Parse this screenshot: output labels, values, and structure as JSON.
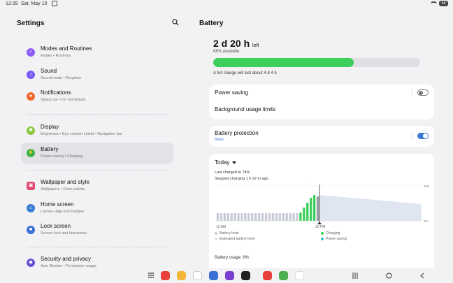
{
  "status": {
    "time": "12:39",
    "date": "Sat, May 10",
    "battery": "68"
  },
  "left": {
    "title": "Settings",
    "groups": [
      {
        "items": [
          {
            "label": "Modes and Routines",
            "sub": "Modes • Routines",
            "icon": "modes-icon",
            "color": "#8b5cf6"
          },
          {
            "label": "Sound",
            "sub": "Sound mode • Ringtone",
            "icon": "sound-icon",
            "color": "#7c5cf6"
          },
          {
            "label": "Notifications",
            "sub": "Status bar • Do not disturb",
            "icon": "bell-icon",
            "color": "#f06a2e"
          }
        ]
      },
      {
        "items": [
          {
            "label": "Display",
            "sub": "Brightness • Eye comfort shield • Navigation bar",
            "icon": "sun-icon",
            "color": "#8cc63f"
          },
          {
            "label": "Battery",
            "sub": "Power saving • Charging",
            "icon": "battery-icon",
            "color": "#3bb34a"
          }
        ]
      },
      {
        "items": [
          {
            "label": "Wallpaper and style",
            "sub": "Wallpapers • Color palette",
            "icon": "wallpaper-icon",
            "color": "#e2476f"
          },
          {
            "label": "Home screen",
            "sub": "Layout • App icon badges",
            "icon": "home-icon",
            "color": "#3a7bd5"
          },
          {
            "label": "Lock screen",
            "sub": "Screen lock and biometrics",
            "icon": "lock-icon",
            "color": "#3a6fd5"
          }
        ]
      },
      {
        "items": [
          {
            "label": "Security and privacy",
            "sub": "Auto Blocker • Permission usage",
            "icon": "shield-icon",
            "color": "#6c4fd6"
          }
        ]
      }
    ]
  },
  "right": {
    "title": "Battery",
    "remaining": "2 d 20 h",
    "remaining_suffix": "left",
    "available": "68% available",
    "level": 0.68,
    "full_charge": "A full charge will last about 4 d 4 h",
    "power_saving": "Power saving",
    "background_limits": "Background usage limits",
    "protection": "Battery protection",
    "protection_mode": "Basic",
    "power_saving_on": false,
    "protection_on": true,
    "today": "Today",
    "last_charged": "Last charged to 74%",
    "stopped": "Stopped charging 1 h 22 m ago",
    "usage": "Battery usage: 8%",
    "legend": {
      "level": "Battery level",
      "estimated": "Estimated battery level",
      "charging": "Charging",
      "power_saving": "Power saving"
    },
    "legend_colors": {
      "level": "#c8ccd4",
      "estimated": "#dfe3ea",
      "charging": "#3ccf5c",
      "power_saving": "#29c0b5"
    }
  },
  "chart_data": {
    "type": "bar",
    "x_labels": [
      "12 AM",
      "12 PM"
    ],
    "y_labels": [
      "100",
      "0%"
    ],
    "marker_label": "⚡74",
    "ylim": [
      0,
      100
    ],
    "values": [
      22,
      22,
      22,
      22,
      22,
      22,
      22,
      22,
      22,
      22,
      22,
      22,
      22,
      22,
      22,
      22,
      22,
      22,
      22,
      22,
      22,
      22,
      22,
      22,
      24,
      38,
      52,
      66,
      74,
      70
    ],
    "charging_flags": [
      0,
      0,
      0,
      0,
      0,
      0,
      0,
      0,
      0,
      0,
      0,
      0,
      0,
      0,
      0,
      0,
      0,
      0,
      0,
      0,
      0,
      0,
      0,
      0,
      1,
      1,
      1,
      1,
      1,
      0
    ],
    "estimated_from": 74,
    "estimated_to": 48
  }
}
